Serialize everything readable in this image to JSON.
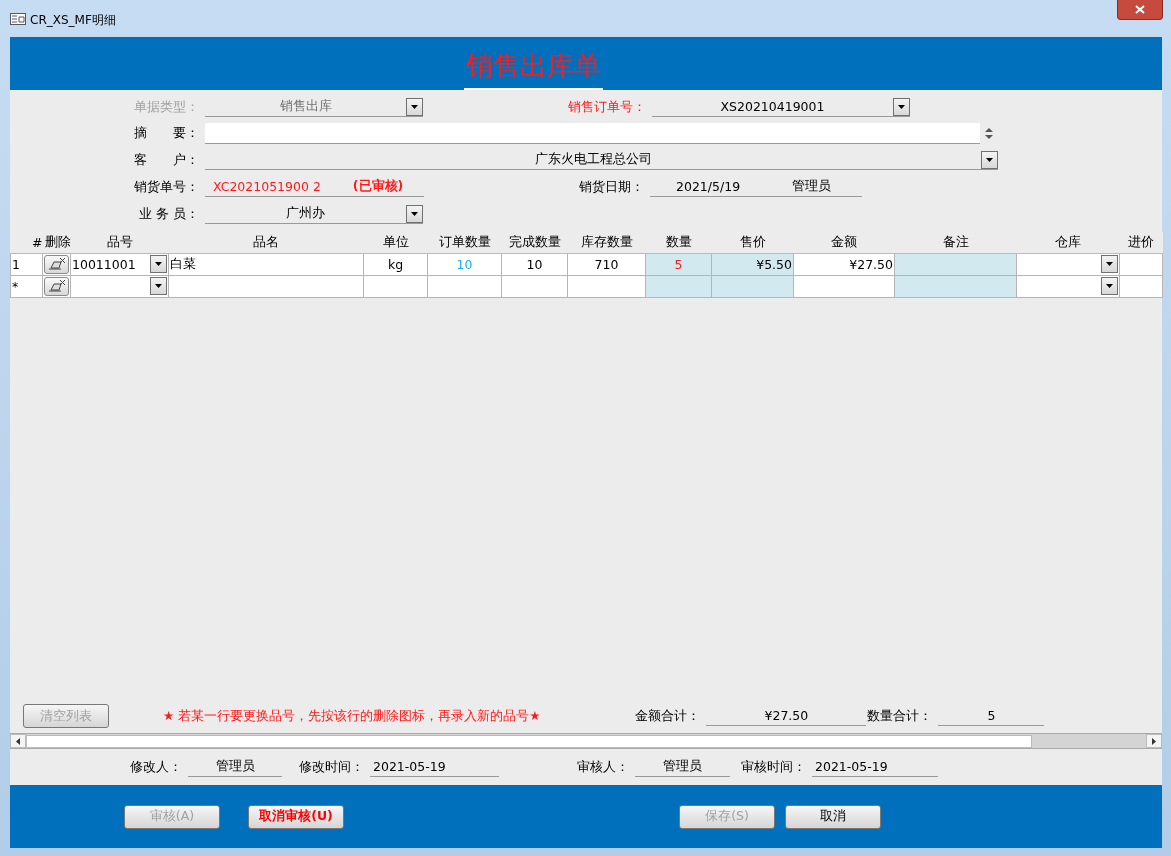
{
  "window": {
    "title": "CR_XS_MF明细"
  },
  "header": {
    "title": "销售出库单"
  },
  "form": {
    "doc_type": {
      "label": "单据类型：",
      "value": "销售出库",
      "disabled": true
    },
    "order_no": {
      "label": "销售订单号：",
      "value": "XS20210419001"
    },
    "summary": {
      "label": "摘　　要："
    },
    "customer": {
      "label": "客　　户：",
      "value": "广东火电工程总公司"
    },
    "delivery_no": {
      "label": "销货单号：",
      "value": "XC2021051900 2",
      "status": "(已审核)"
    },
    "delivery_date": {
      "label": "销货日期：",
      "value": "2021/5/19",
      "operator": "管理员"
    },
    "salesman": {
      "label": "业 务 员：",
      "value": "广州办"
    }
  },
  "grid": {
    "columns": [
      {
        "label": "#",
        "shaded": false
      },
      {
        "label": "删除",
        "shaded": false
      },
      {
        "label": "品号",
        "shaded": false
      },
      {
        "label": "品名",
        "shaded": false
      },
      {
        "label": "单位",
        "shaded": false
      },
      {
        "label": "订单数量",
        "shaded": false
      },
      {
        "label": "完成数量",
        "shaded": false
      },
      {
        "label": "库存数量",
        "shaded": false
      },
      {
        "label": "数量",
        "shaded": true
      },
      {
        "label": "售价",
        "shaded": true
      },
      {
        "label": "金额",
        "shaded": false
      },
      {
        "label": "备注",
        "shaded": true
      },
      {
        "label": "仓库",
        "shaded": false
      },
      {
        "label": "进价",
        "shaded": false
      }
    ],
    "rows": [
      {
        "index": "1",
        "item_no": "10011001",
        "name": "白菜",
        "unit": "kg",
        "order_qty": "10",
        "done_qty": "10",
        "stock_qty": "710",
        "qty": "5",
        "price": "¥5.50",
        "amount": "¥27.50"
      }
    ],
    "new_row": {
      "index": "*"
    }
  },
  "footer": {
    "clear_button": {
      "label": "清空列表",
      "disabled": true
    },
    "note": "★ 若某一行要更换品号，先按该行的删除图标，再录入新的品号★",
    "total_amount": {
      "label": "金额合计：",
      "value": "¥27.50"
    },
    "total_qty": {
      "label": "数量合计：",
      "value": "5"
    }
  },
  "audit": {
    "modifier": {
      "label": "修改人：",
      "value": "管理员"
    },
    "modified_time": {
      "label": "修改时间：",
      "value": "2021-05-19"
    },
    "reviewer": {
      "label": "审核人：",
      "value": "管理员"
    },
    "review_time": {
      "label": "审核时间：",
      "value": "2021-05-19"
    }
  },
  "buttons": [
    {
      "label": "审核(A)",
      "disabled": true,
      "kind": "normal"
    },
    {
      "label": "取消审核(U)",
      "disabled": false,
      "kind": "danger"
    },
    {
      "label": "保存(S)",
      "disabled": true,
      "kind": "normal"
    },
    {
      "label": "取消",
      "disabled": false,
      "kind": "normal"
    }
  ]
}
